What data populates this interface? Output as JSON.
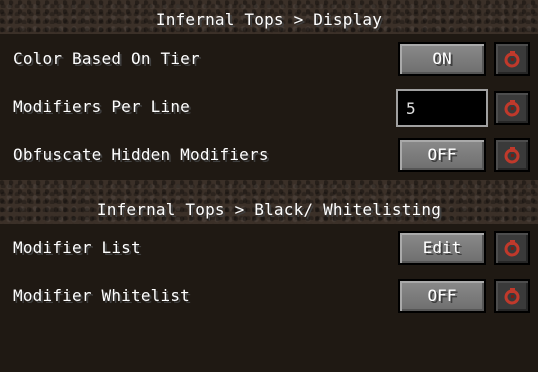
{
  "sections": [
    {
      "title": "Infernal Tops > Display",
      "rows": [
        {
          "label": "Color Based On Tier",
          "control": "toggle",
          "value": "ON"
        },
        {
          "label": "Modifiers Per Line",
          "control": "text",
          "value": "5"
        },
        {
          "label": "Obfuscate Hidden Modifiers",
          "control": "toggle",
          "value": "OFF"
        }
      ]
    },
    {
      "title": "Infernal Tops > Black/ Whitelisting",
      "rows": [
        {
          "label": "Modifier List",
          "control": "button",
          "value": "Edit"
        },
        {
          "label": "Modifier Whitelist",
          "control": "toggle",
          "value": "OFF"
        }
      ]
    }
  ],
  "icons": {
    "reset": "reset-icon"
  },
  "colors": {
    "reset_icon": "#c0392b",
    "panel": "#1f1913",
    "button": "#7b7b7b"
  }
}
